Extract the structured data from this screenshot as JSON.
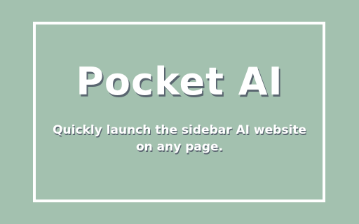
{
  "title": "Pocket AI",
  "subtitle_line1": "Quickly launch the sidebar AI website",
  "subtitle_line2": "on any page.",
  "colors": {
    "background": "#a3c1af",
    "text": "#ffffff",
    "shadow": "#5a6670",
    "frame": "#ffffff"
  }
}
